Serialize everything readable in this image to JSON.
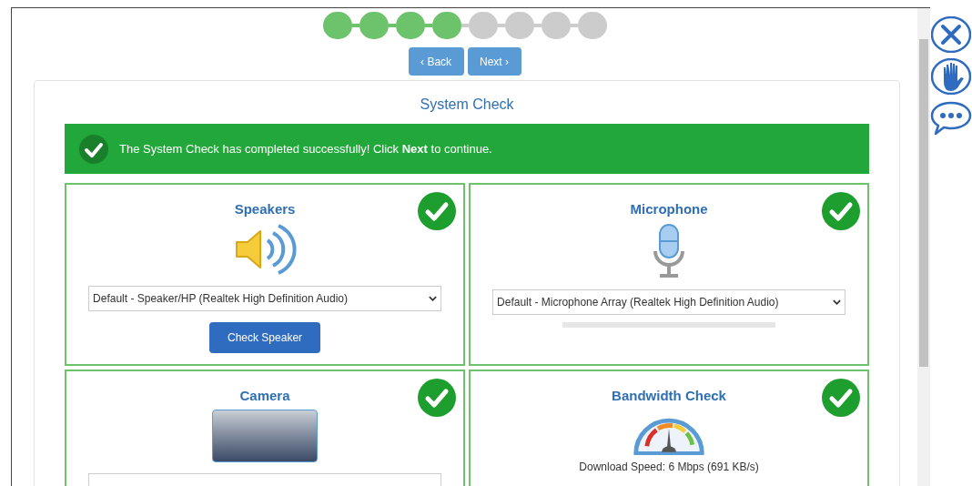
{
  "steps": [
    {
      "done": true
    },
    {
      "done": true
    },
    {
      "done": true
    },
    {
      "done": true
    },
    {
      "done": false
    },
    {
      "done": false
    },
    {
      "done": false
    },
    {
      "done": false
    }
  ],
  "nav": {
    "back": "Back",
    "next": "Next",
    "back_glyph": "‹",
    "next_glyph": "›"
  },
  "title": "System Check",
  "banner": {
    "text": "The System Check has completed successfully! Click **Next** to continue.",
    "success": true
  },
  "checks": [
    {
      "kind": "speakers",
      "title": "Speakers",
      "passed": true,
      "device": "Default - Speaker/HP (Realtek High Definition Audio)",
      "button": "Check Speaker"
    },
    {
      "kind": "microphone",
      "title": "Microphone",
      "passed": true,
      "device": "Default - Microphone Array (Realtek High Definition Audio)"
    },
    {
      "kind": "camera",
      "title": "Camera",
      "passed": true
    },
    {
      "kind": "bandwidth",
      "title": "Bandwidth Check",
      "passed": true,
      "reading": "Download Speed: 6 Mbps (691 KB/s)"
    }
  ]
}
